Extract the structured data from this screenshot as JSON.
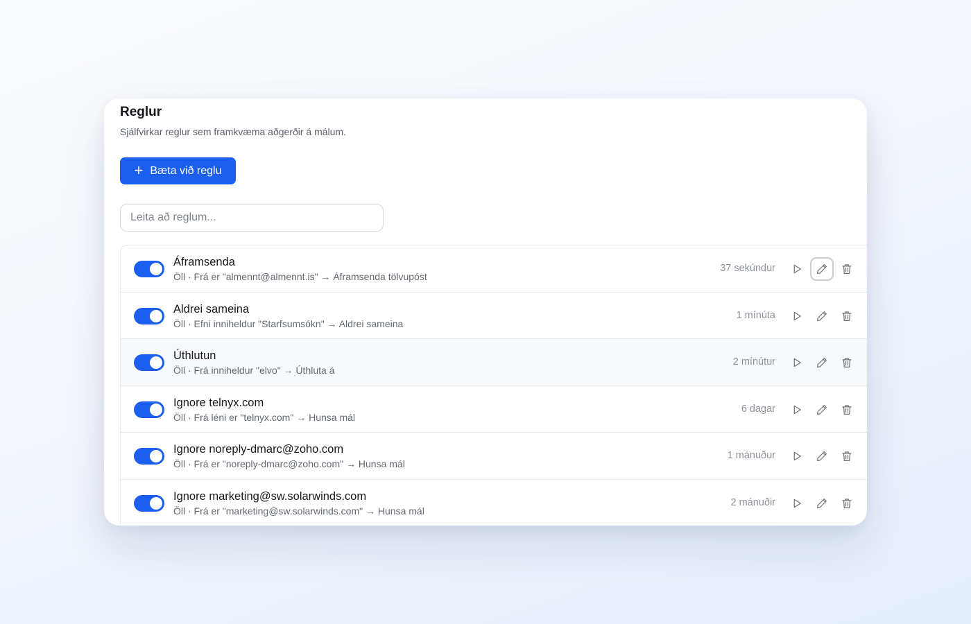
{
  "header": {
    "title": "Reglur",
    "subtitle": "Sjálfvirkar reglur sem framkvæma aðgerðir á málum."
  },
  "add_button": {
    "label": "Bæta við reglu",
    "icon": "plus-icon"
  },
  "search": {
    "placeholder": "Leita að reglum...",
    "value": ""
  },
  "rules": [
    {
      "name": "Áframsenda",
      "description": "Öll · Frá er \"almennt@almennt.is\" → Áframsenda tölvupóst",
      "time": "37 sekúndur",
      "enabled": true
    },
    {
      "name": "Aldrei sameina",
      "description": "Öll · Efni inniheldur \"Starfsumsókn\" → Aldrei sameina",
      "time": "1 mínúta",
      "enabled": true
    },
    {
      "name": "Úthlutun",
      "description": "Öll · Frá inniheldur \"elvo\" → Úthluta á",
      "time": "2 mínútur",
      "enabled": true
    },
    {
      "name": "Ignore telnyx.com",
      "description": "Öll · Frá léni er \"telnyx.com\" → Hunsa mál",
      "time": "6 dagar",
      "enabled": true
    },
    {
      "name": "Ignore noreply-dmarc@zoho.com",
      "description": "Öll · Frá er \"noreply-dmarc@zoho.com\" → Hunsa mál",
      "time": "1 mánuður",
      "enabled": true
    },
    {
      "name": "Ignore marketing@sw.solarwinds.com",
      "description": "Öll · Frá er \"marketing@sw.solarwinds.com\" → Hunsa mál",
      "time": "2 mánuðir",
      "enabled": true
    }
  ],
  "row_actions": {
    "run_icon": "play-icon",
    "edit_icon": "pencil-icon",
    "delete_icon": "trash-icon"
  },
  "colors": {
    "accent": "#1c5fef",
    "muted_text": "#626870",
    "time_text": "#8c9199"
  }
}
